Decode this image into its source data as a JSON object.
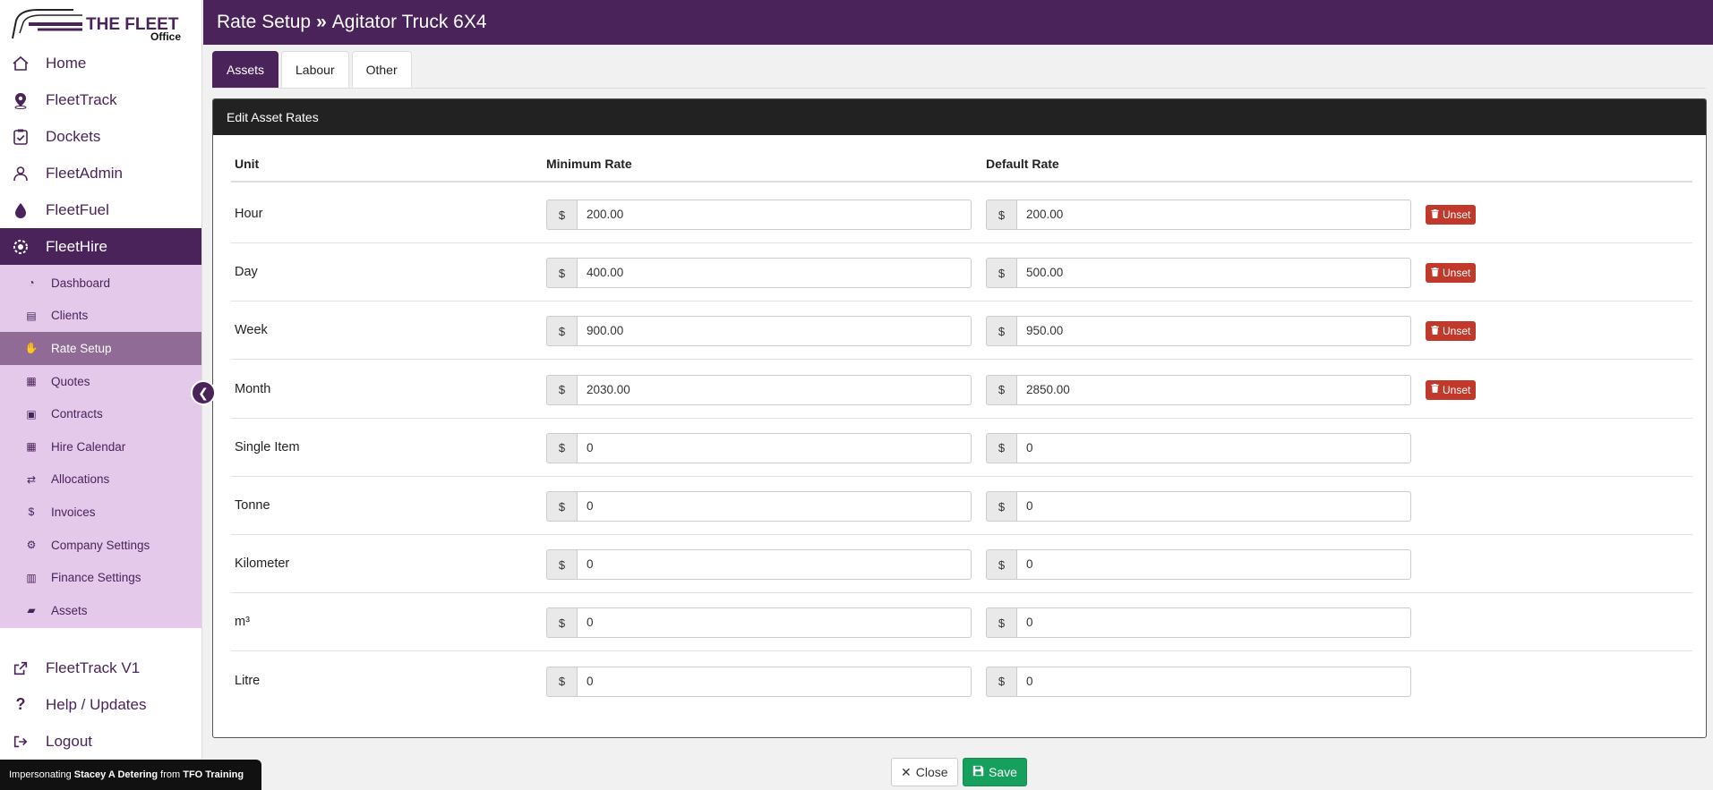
{
  "app": {
    "logo_text": "THE FLEET",
    "logo_sub": "Office"
  },
  "header": {
    "section": "Rate Setup",
    "separator": "»",
    "asset": "Agitator Truck 6X4"
  },
  "nav": {
    "items": [
      {
        "label": "Home",
        "icon": "home-icon"
      },
      {
        "label": "FleetTrack",
        "icon": "map-pin-icon"
      },
      {
        "label": "Dockets",
        "icon": "clipboard-check-icon"
      },
      {
        "label": "FleetAdmin",
        "icon": "user-admin-icon"
      },
      {
        "label": "FleetFuel",
        "icon": "fuel-drop-icon"
      },
      {
        "label": "FleetHire",
        "icon": "hire-gear-icon"
      }
    ],
    "sub_items": [
      {
        "label": "Dashboard",
        "icon": "dashboard-icon"
      },
      {
        "label": "Clients",
        "icon": "id-card-icon"
      },
      {
        "label": "Rate Setup",
        "icon": "hand-coin-icon"
      },
      {
        "label": "Quotes",
        "icon": "quote-icon"
      },
      {
        "label": "Contracts",
        "icon": "briefcase-icon"
      },
      {
        "label": "Hire Calendar",
        "icon": "calendar-icon"
      },
      {
        "label": "Allocations",
        "icon": "allocations-icon"
      },
      {
        "label": "Invoices",
        "icon": "dollar-icon"
      },
      {
        "label": "Company Settings",
        "icon": "cogs-icon"
      },
      {
        "label": "Finance Settings",
        "icon": "file-invoice-icon"
      },
      {
        "label": "Assets",
        "icon": "truck-icon"
      }
    ],
    "bottom_items": [
      {
        "label": "FleetTrack V1",
        "icon": "external-link-icon"
      },
      {
        "label": "Help / Updates",
        "icon": "question-icon"
      },
      {
        "label": "Logout",
        "icon": "logout-icon"
      }
    ]
  },
  "impersonation": {
    "prefix": "Impersonating",
    "user": "Stacey A Detering",
    "mid": "from",
    "org": "TFO Training"
  },
  "tabs": [
    {
      "label": "Assets",
      "active": true
    },
    {
      "label": "Labour",
      "active": false
    },
    {
      "label": "Other",
      "active": false
    }
  ],
  "panel": {
    "title": "Edit Asset Rates",
    "columns": {
      "unit": "Unit",
      "min": "Minimum Rate",
      "def": "Default Rate"
    },
    "currency": "$",
    "unset_label": "Unset",
    "rows": [
      {
        "unit": "Hour",
        "min": "200.00",
        "def": "200.00",
        "unset": true
      },
      {
        "unit": "Day",
        "min": "400.00",
        "def": "500.00",
        "unset": true
      },
      {
        "unit": "Week",
        "min": "900.00",
        "def": "950.00",
        "unset": true
      },
      {
        "unit": "Month",
        "min": "2030.00",
        "def": "2850.00",
        "unset": true
      },
      {
        "unit": "Single Item",
        "min": "0",
        "def": "0",
        "unset": false
      },
      {
        "unit": "Tonne",
        "min": "0",
        "def": "0",
        "unset": false
      },
      {
        "unit": "Kilometer",
        "min": "0",
        "def": "0",
        "unset": false
      },
      {
        "unit": "m³",
        "min": "0",
        "def": "0",
        "unset": false
      },
      {
        "unit": "Litre",
        "min": "0",
        "def": "0",
        "unset": false
      }
    ]
  },
  "footer": {
    "close_label": "Close",
    "save_label": "Save"
  },
  "colors": {
    "brand": "#4a235a",
    "subnav_bg": "#e5c9eb",
    "subnav_active": "#8f6b96",
    "unset": "#c0392b",
    "save": "#16a05d"
  }
}
